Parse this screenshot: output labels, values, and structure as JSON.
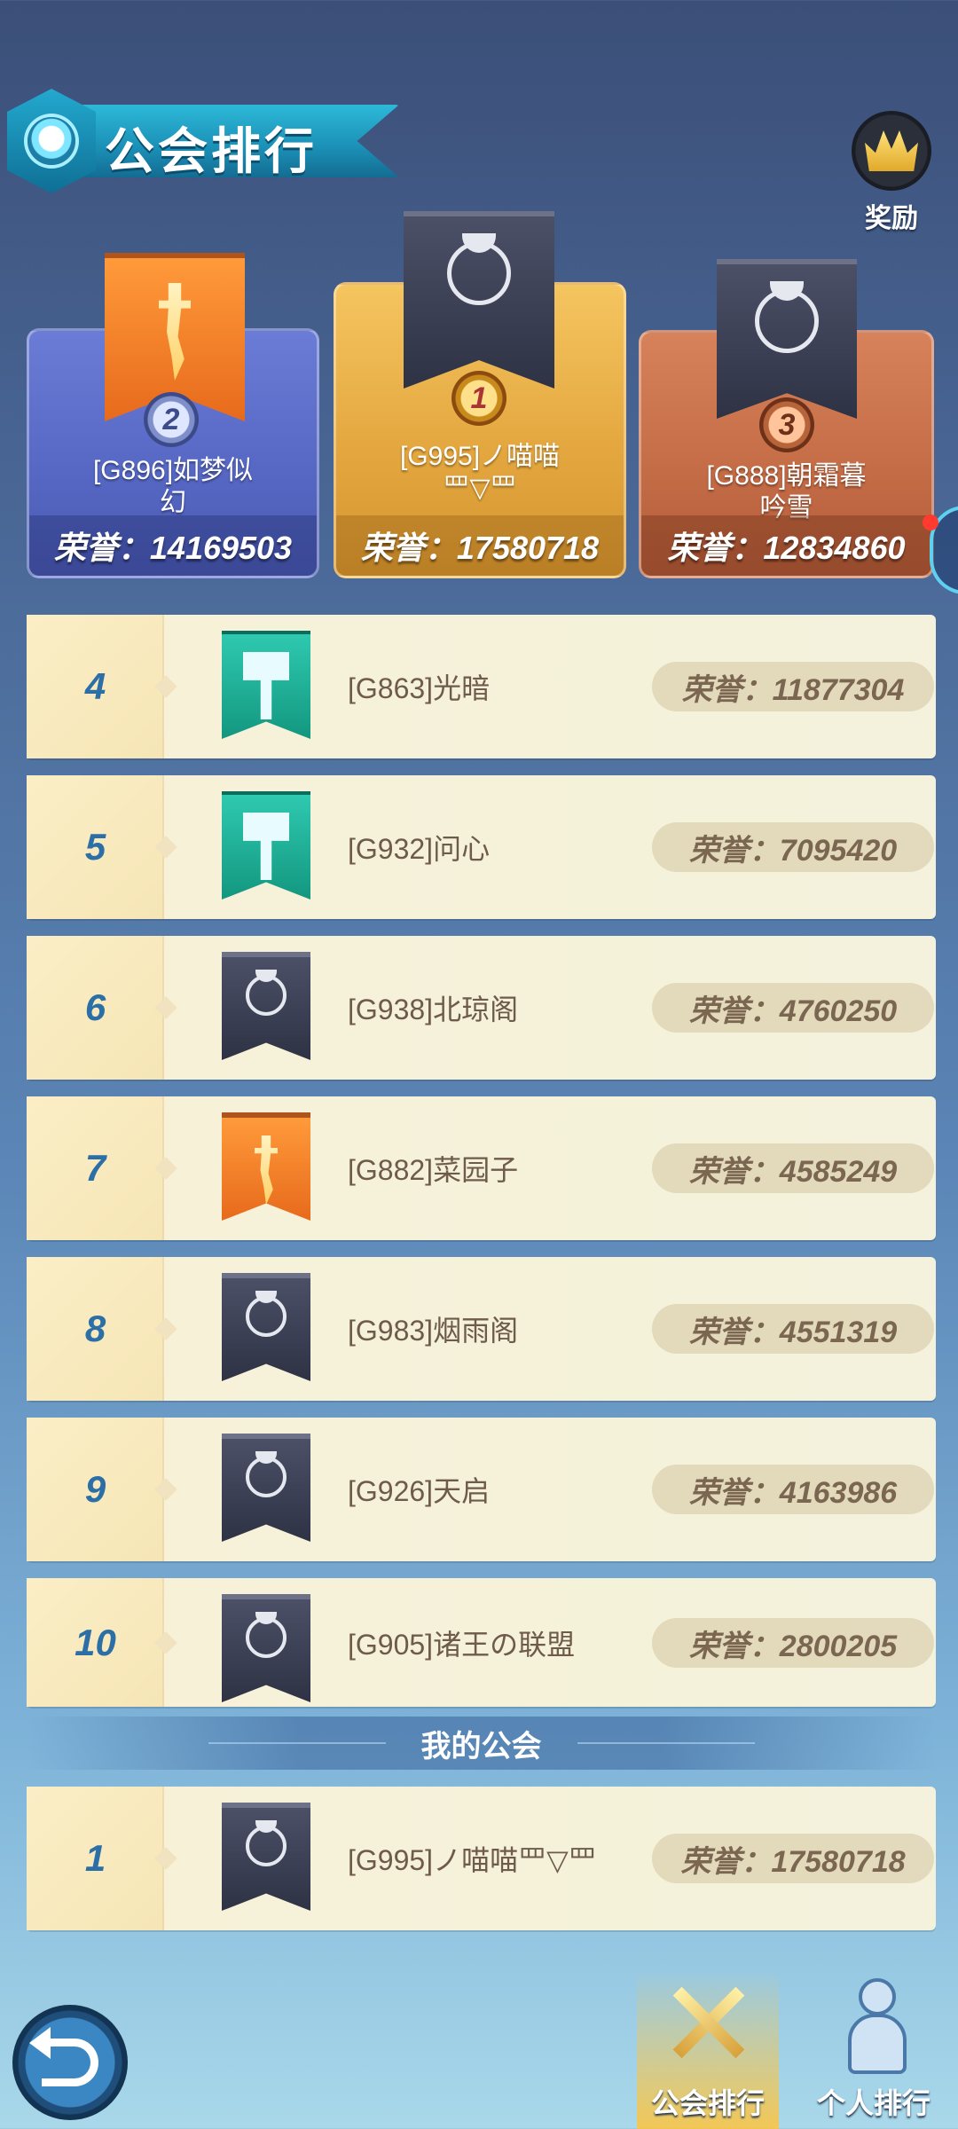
{
  "header": {
    "title": "公会排行",
    "reward_label": "奖励"
  },
  "podium": [
    {
      "rank": "2",
      "name_line1": "[G896]如梦似",
      "name_line2": "幻",
      "score": "荣誉：14169503",
      "banner": "sword-icon"
    },
    {
      "rank": "1",
      "name_line1": "[G995]ノ喵喵",
      "name_line2": "罒▽罒",
      "score": "荣誉：17580718",
      "banner": "moon-icon"
    },
    {
      "rank": "3",
      "name_line1": "[G888]朝霜暮",
      "name_line2": "吟雪",
      "score": "荣誉：12834860",
      "banner": "moon-icon"
    }
  ],
  "rows": [
    {
      "rank": "4",
      "name": "[G863]光暗",
      "score": "荣誉：11877304",
      "banner": "hammer-icon"
    },
    {
      "rank": "5",
      "name": "[G932]问心",
      "score": "荣誉：7095420",
      "banner": "hammer-icon"
    },
    {
      "rank": "6",
      "name": "[G938]北琼阁",
      "score": "荣誉：4760250",
      "banner": "moon-icon"
    },
    {
      "rank": "7",
      "name": "[G882]菜园子",
      "score": "荣誉：4585249",
      "banner": "sword-icon"
    },
    {
      "rank": "8",
      "name": "[G983]烟雨阁",
      "score": "荣誉：4551319",
      "banner": "moon-icon"
    },
    {
      "rank": "9",
      "name": "[G926]天启",
      "score": "荣誉：4163986",
      "banner": "moon-icon"
    },
    {
      "rank": "10",
      "name": "[G905]诸王の联盟",
      "score": "荣誉：2800205",
      "banner": "moon-icon"
    }
  ],
  "my_guild": {
    "title": "我的公会",
    "rank": "1",
    "name": "[G995]ノ喵喵罒▽罒",
    "score": "荣誉：17580718",
    "banner": "moon-icon"
  },
  "bottom_tabs": [
    {
      "label": "公会排行",
      "icon": "crossed-swords-icon",
      "active": true
    },
    {
      "label": "个人排行",
      "icon": "person-icon",
      "active": false
    }
  ],
  "colors": {
    "rank_number": "#2b6fa6",
    "row_background": "#f4f2dc",
    "podium_first": "#e3a53d",
    "podium_second": "#5567c3",
    "podium_third": "#c36b45"
  }
}
